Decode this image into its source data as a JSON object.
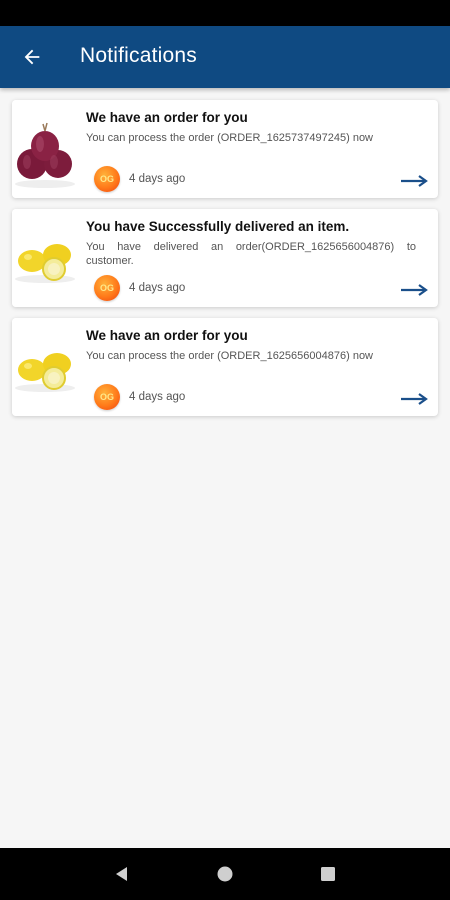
{
  "header": {
    "title": "Notifications",
    "background_color": "#0f4a82",
    "back_icon": "arrow-left-icon"
  },
  "notifications": [
    {
      "title": "We have an order for you",
      "message": "You can process the order (ORDER_1625737497245) now",
      "time": "4 days ago",
      "image": "red-onion",
      "logo_text": "OG"
    },
    {
      "title": "You have Successfully delivered an item.",
      "message": "You have delivered an order(ORDER_1625656004876) to customer.",
      "time": "4 days ago",
      "image": "lemons",
      "logo_text": "OG"
    },
    {
      "title": "We have an order for you",
      "message": "You can process the order (ORDER_1625656004876) now",
      "time": "4 days ago",
      "image": "lemons",
      "logo_text": "OG"
    }
  ],
  "accent_color": "#1a4f8a",
  "system_nav": [
    "back-triangle-icon",
    "home-circle-icon",
    "recents-square-icon"
  ]
}
